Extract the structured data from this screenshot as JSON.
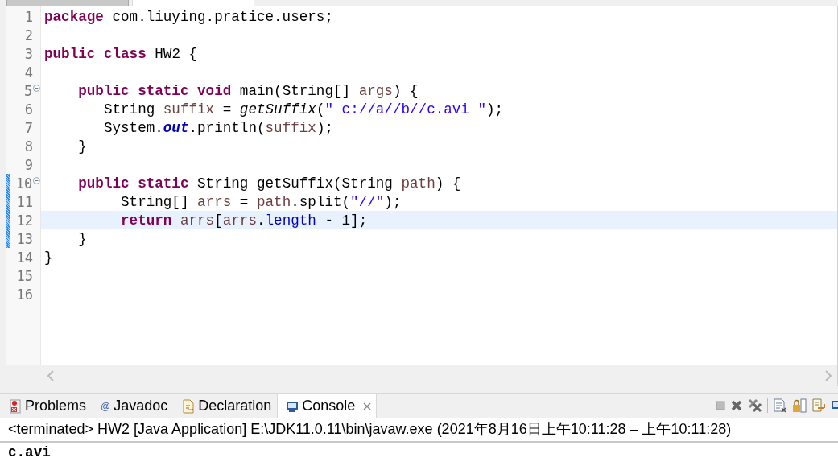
{
  "editor_tabs": [
    {
      "selected": false
    },
    {
      "selected": true
    }
  ],
  "editor": {
    "lines": [
      {
        "number": "1",
        "fold": false,
        "changed": false,
        "current": false,
        "tokens": [
          {
            "kind": "keyword",
            "text": "package"
          },
          {
            "kind": "plain",
            "text": " com.liuying.pratice.users;"
          }
        ]
      },
      {
        "number": "2",
        "fold": false,
        "changed": false,
        "current": false
      },
      {
        "number": "3",
        "fold": false,
        "changed": false,
        "current": false,
        "tokens": [
          {
            "kind": "keyword",
            "text": "public class"
          },
          {
            "kind": "plain",
            "text": " HW2 {"
          }
        ]
      },
      {
        "number": "4",
        "fold": false,
        "changed": false,
        "current": false
      },
      {
        "number": "5",
        "fold": true,
        "changed": false,
        "current": false,
        "tokens": [
          {
            "kind": "keyword",
            "text": "    public static void"
          },
          {
            "kind": "plain",
            "text": " main(String[] "
          },
          {
            "kind": "variable",
            "text": "args"
          },
          {
            "kind": "plain",
            "text": ") {"
          }
        ]
      },
      {
        "number": "6",
        "fold": false,
        "changed": false,
        "current": false,
        "tokens": [
          {
            "kind": "plain",
            "text": "       String "
          },
          {
            "kind": "variable",
            "text": "suffix"
          },
          {
            "kind": "plain",
            "text": " = "
          },
          {
            "kind": "method",
            "text": "getSuffix"
          },
          {
            "kind": "plain",
            "text": "("
          },
          {
            "kind": "string",
            "text": "\" c://a//b//c.avi \""
          },
          {
            "kind": "plain",
            "text": ");"
          }
        ]
      },
      {
        "number": "7",
        "fold": false,
        "changed": false,
        "current": false,
        "tokens": [
          {
            "kind": "plain",
            "text": "       System."
          },
          {
            "kind": "static-field",
            "text": "out"
          },
          {
            "kind": "plain",
            "text": ".println("
          },
          {
            "kind": "variable",
            "text": "suffix"
          },
          {
            "kind": "plain",
            "text": ");"
          }
        ]
      },
      {
        "number": "8",
        "fold": false,
        "changed": false,
        "current": false,
        "tokens": [
          {
            "kind": "plain",
            "text": "    }"
          }
        ]
      },
      {
        "number": "9",
        "fold": false,
        "changed": false,
        "current": false
      },
      {
        "number": "10",
        "fold": true,
        "changed": true,
        "current": false,
        "tokens": [
          {
            "kind": "keyword",
            "text": "    public static"
          },
          {
            "kind": "plain",
            "text": " String getSuffix(String "
          },
          {
            "kind": "variable",
            "text": "path"
          },
          {
            "kind": "plain",
            "text": ") {"
          }
        ]
      },
      {
        "number": "11",
        "fold": false,
        "changed": true,
        "current": false,
        "tokens": [
          {
            "kind": "plain",
            "text": "         String[] "
          },
          {
            "kind": "variable",
            "text": "arrs"
          },
          {
            "kind": "plain",
            "text": " = "
          },
          {
            "kind": "variable",
            "text": "path"
          },
          {
            "kind": "plain",
            "text": ".split("
          },
          {
            "kind": "string",
            "text": "\"//\""
          },
          {
            "kind": "plain",
            "text": ");"
          }
        ]
      },
      {
        "number": "12",
        "fold": false,
        "changed": true,
        "current": true,
        "tokens": [
          {
            "kind": "keyword",
            "text": "         return"
          },
          {
            "kind": "variable",
            "text": " arrs"
          },
          {
            "kind": "plain",
            "text": "["
          },
          {
            "kind": "variable",
            "text": "arrs"
          },
          {
            "kind": "plain",
            "text": "."
          },
          {
            "kind": "field",
            "text": "length"
          },
          {
            "kind": "plain",
            "text": " - 1];"
          }
        ]
      },
      {
        "number": "13",
        "fold": false,
        "changed": true,
        "current": false,
        "tokens": [
          {
            "kind": "plain",
            "text": "    }"
          }
        ]
      },
      {
        "number": "14",
        "fold": false,
        "changed": false,
        "current": false,
        "tokens": [
          {
            "kind": "plain",
            "text": "}"
          }
        ]
      },
      {
        "number": "15",
        "fold": false,
        "changed": false,
        "current": false
      },
      {
        "number": "16",
        "fold": false,
        "changed": false,
        "current": false
      }
    ]
  },
  "panel_tabs": [
    {
      "kind": "problems",
      "label": "Problems",
      "selected": false
    },
    {
      "kind": "javadoc",
      "icon": "@",
      "label": "Javadoc",
      "selected": false
    },
    {
      "kind": "declaration",
      "label": "Declaration",
      "selected": false
    },
    {
      "kind": "console",
      "label": "Console",
      "selected": true
    }
  ],
  "console": {
    "header": "<terminated> HW2 [Java Application] E:\\JDK11.0.11\\bin\\javaw.exe  (2021年8月16日上午10:11:28 – 上午10:11:28)",
    "output": "c.avi"
  }
}
